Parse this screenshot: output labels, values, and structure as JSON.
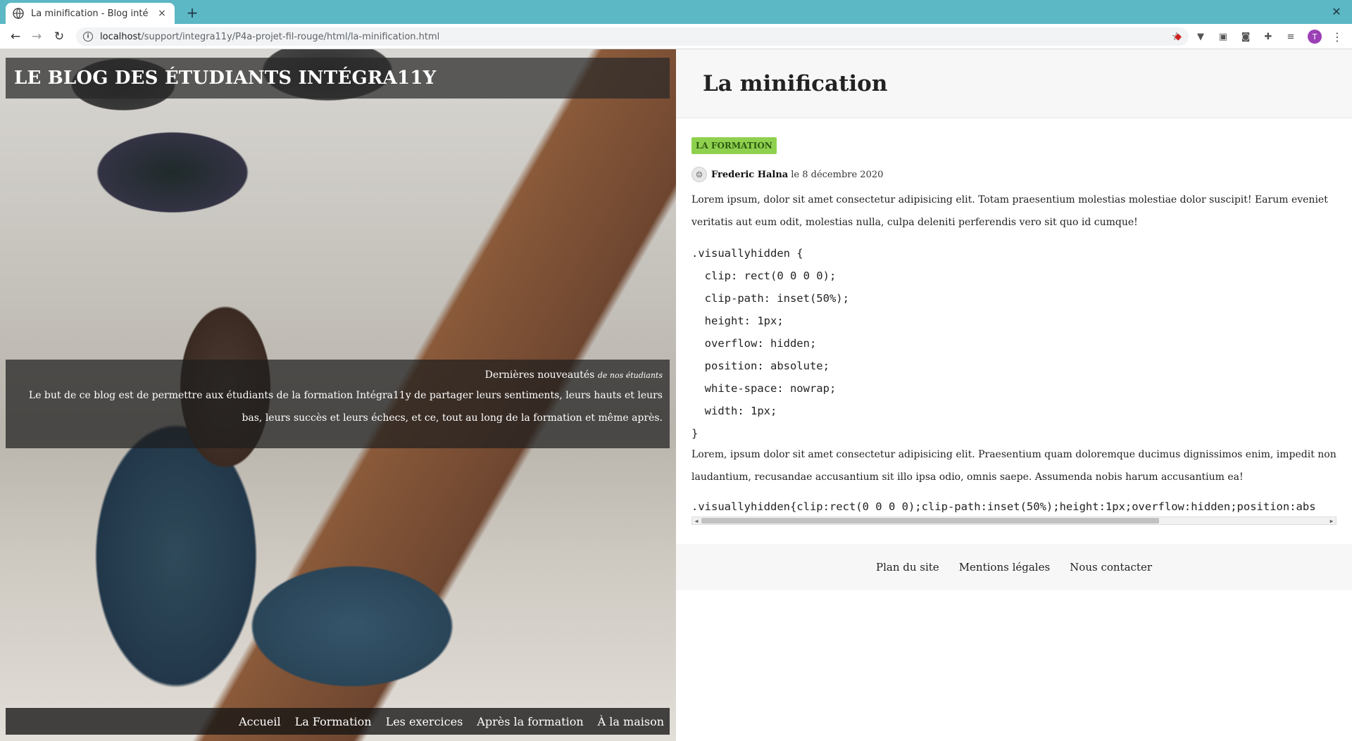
{
  "browser": {
    "tab_title": "La minification - Blog inté",
    "tab_close": "×",
    "new_tab": "+",
    "window_close": "✕",
    "url_host": "localhost",
    "url_path": "/support/integra11y/P4a-projet-fil-rouge/html/la-minification.html",
    "avatar_letter": "T"
  },
  "hero": {
    "blog_title": "LE BLOG DES ÉTUDIANTS INTÉGRA11Y",
    "caption_heading": "Dernières nouveautés",
    "caption_emphasis": "de nos étudiants",
    "caption_body": "Le but de ce blog est de permettre aux étudiants de la formation Intégra11y de partager leurs sentiments, leurs hauts et leurs bas, leurs succès et leurs échecs, et ce, tout au long de la formation et même après.",
    "nav": [
      "Accueil",
      "La Formation",
      "Les exercices",
      "Après la formation",
      "À la maison"
    ]
  },
  "article": {
    "title": "La minification",
    "tag": "LA FORMATION",
    "author": "Frederic Halna",
    "date": "le 8 décembre 2020",
    "para1": "Lorem ipsum, dolor sit amet consectetur adipisicing elit. Totam praesentium molestias molestiae dolor suscipit! Earum eveniet veritatis aut eum odit, molestias nulla, culpa deleniti perferendis vero sit quo id cumque!",
    "code_lines": [
      ".visuallyhidden {",
      "  clip: rect(0 0 0 0);",
      "  clip-path: inset(50%);",
      "  height: 1px;",
      "  overflow: hidden;",
      "  position: absolute;",
      "  white-space: nowrap;",
      "  width: 1px;",
      "}"
    ],
    "para2": "Lorem, ipsum dolor sit amet consectetur adipisicing elit. Praesentium quam doloremque ducimus dignissimos enim, impedit non laudantium, recusandae accusantium sit illo ipsa odio, omnis saepe. Assumenda nobis harum accusantium ea!",
    "code_minified": ".visuallyhidden{clip:rect(0 0 0 0);clip-path:inset(50%);height:1px;overflow:hidden;position:abs"
  },
  "footer": {
    "links": [
      "Plan du site",
      "Mentions légales",
      "Nous contacter"
    ]
  }
}
